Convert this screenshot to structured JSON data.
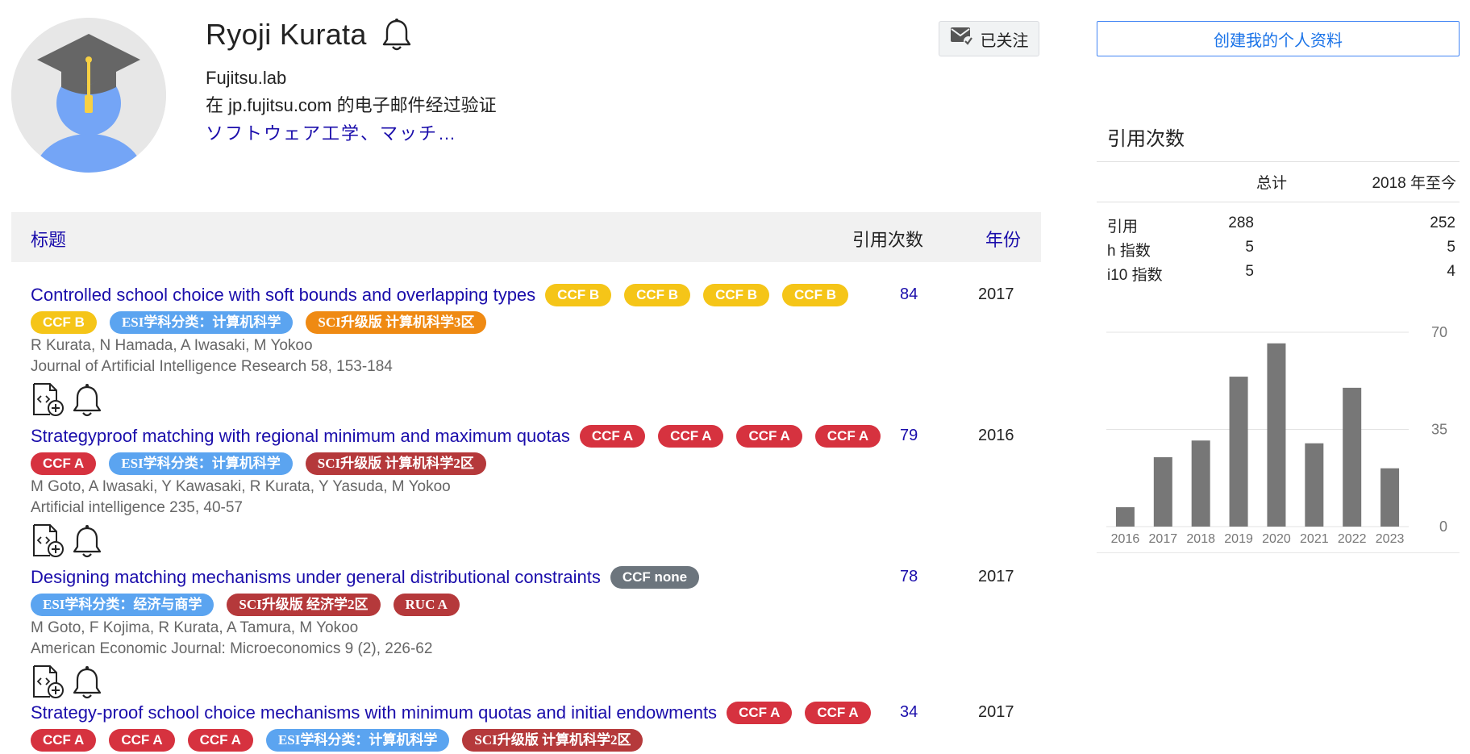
{
  "profile": {
    "name": "Ryoji Kurata",
    "affiliation": "Fujitsu.lab",
    "verified_email": "在 jp.fujitsu.com 的电子邮件经过验证",
    "interests": "ソフトウェア工学、マッチ…",
    "follow_label": "已关注",
    "create_profile_label": "创建我的个人资料"
  },
  "table_header": {
    "title": "标题",
    "cited_by": "引用次数",
    "year": "年份"
  },
  "publications": [
    {
      "title": "Controlled school choice with soft bounds and overlapping types",
      "badges": [
        {
          "text": "CCF B",
          "kind": "ccf-b"
        },
        {
          "text": "CCF B",
          "kind": "ccf-b"
        },
        {
          "text": "CCF B",
          "kind": "ccf-b"
        },
        {
          "text": "CCF B",
          "kind": "ccf-b"
        },
        {
          "text": "CCF B",
          "kind": "ccf-b"
        },
        {
          "text": "ESI学科分类：计算机科学",
          "kind": "esi"
        },
        {
          "text": "SCI升级版 计算机科学3区",
          "kind": "sci-o"
        }
      ],
      "authors": "R Kurata, N Hamada, A Iwasaki, M Yokoo",
      "venue": "Journal of Artificial Intelligence Research 58, 153-184",
      "cited_by": "84",
      "year": "2017"
    },
    {
      "title": "Strategyproof matching with regional minimum and maximum quotas",
      "badges": [
        {
          "text": "CCF A",
          "kind": "ccf-a"
        },
        {
          "text": "CCF A",
          "kind": "ccf-a"
        },
        {
          "text": "CCF A",
          "kind": "ccf-a"
        },
        {
          "text": "CCF A",
          "kind": "ccf-a"
        },
        {
          "text": "CCF A",
          "kind": "ccf-a"
        },
        {
          "text": "ESI学科分类：计算机科学",
          "kind": "esi"
        },
        {
          "text": "SCI升级版 计算机科学2区",
          "kind": "sci-r"
        }
      ],
      "authors": "M Goto, A Iwasaki, Y Kawasaki, R Kurata, Y Yasuda, M Yokoo",
      "venue": "Artificial intelligence 235, 40-57",
      "cited_by": "79",
      "year": "2016"
    },
    {
      "title": "Designing matching mechanisms under general distributional constraints",
      "badges": [
        {
          "text": "CCF none",
          "kind": "ccf-none"
        },
        {
          "text": "ESI学科分类：经济与商学",
          "kind": "esi"
        },
        {
          "text": "SCI升级版 经济学2区",
          "kind": "sci-r"
        },
        {
          "text": "RUC A",
          "kind": "ruc"
        }
      ],
      "authors": "M Goto, F Kojima, R Kurata, A Tamura, M Yokoo",
      "venue": "American Economic Journal: Microeconomics 9 (2), 226-62",
      "cited_by": "78",
      "year": "2017"
    },
    {
      "title": "Strategy-proof school choice mechanisms with minimum quotas and initial endowments",
      "badges": [
        {
          "text": "CCF A",
          "kind": "ccf-a"
        },
        {
          "text": "CCF A",
          "kind": "ccf-a"
        },
        {
          "text": "CCF A",
          "kind": "ccf-a"
        },
        {
          "text": "CCF A",
          "kind": "ccf-a"
        },
        {
          "text": "CCF A",
          "kind": "ccf-a"
        },
        {
          "text": "ESI学科分类：计算机科学",
          "kind": "esi"
        },
        {
          "text": "SCI升级版 计算机科学2区",
          "kind": "sci-r"
        }
      ],
      "authors": "",
      "venue": "",
      "cited_by": "34",
      "year": "2017"
    }
  ],
  "citations": {
    "heading": "引用次数",
    "col_total": "总计",
    "col_since": "2018 年至今",
    "rows": [
      {
        "label": "引用",
        "total": "288",
        "since": "252"
      },
      {
        "label": "h 指数",
        "total": "5",
        "since": "5"
      },
      {
        "label": "i10 指数",
        "total": "5",
        "since": "4"
      }
    ]
  },
  "chart_data": {
    "type": "bar",
    "categories": [
      "2016",
      "2017",
      "2018",
      "2019",
      "2020",
      "2021",
      "2022",
      "2023"
    ],
    "values": [
      7,
      25,
      31,
      54,
      66,
      30,
      50,
      21
    ],
    "ylim": [
      0,
      70
    ],
    "yticks": [
      "0",
      "35",
      "70"
    ],
    "bar_color": "#777777",
    "grid": true
  },
  "colors": {
    "link": "#1a0dab",
    "ccf_b": "#f5c518",
    "ccf_a": "#d6323f",
    "esi": "#5ba4f0",
    "sci_orange": "#ef8a13",
    "sci_red": "#b5393b",
    "ccf_none": "#6c757d"
  }
}
